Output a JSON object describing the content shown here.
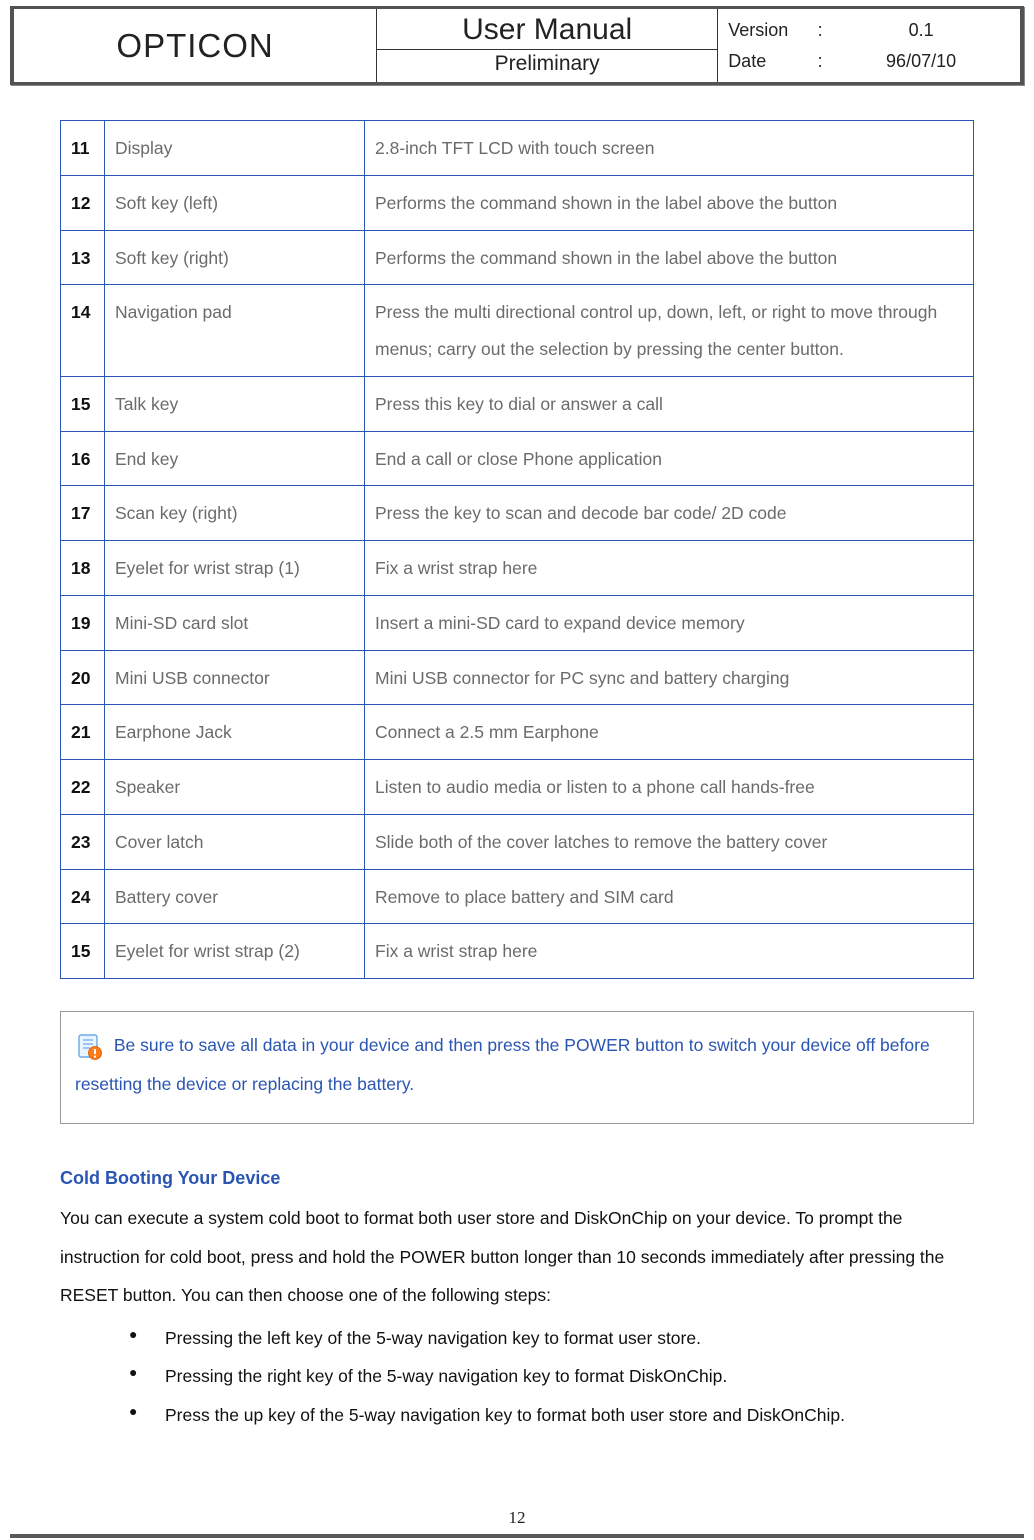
{
  "header": {
    "brand": "OPTICON",
    "title": "User Manual",
    "subtitle": "Preliminary",
    "meta": {
      "version_label": "Version",
      "version_value": "0.1",
      "date_label": "Date",
      "date_value": "96/07/10",
      "colon": ":"
    }
  },
  "parts": [
    {
      "num": "11",
      "name": "Display",
      "desc": "2.8-inch TFT LCD with touch screen"
    },
    {
      "num": "12",
      "name": "Soft key (left)",
      "desc": "Performs the command shown in the label above the button"
    },
    {
      "num": "13",
      "name": "Soft key (right)",
      "desc": "Performs the command shown in the label above the button"
    },
    {
      "num": "14",
      "name": "Navigation pad",
      "desc": "Press the multi directional control up, down, left, or right to move through menus; carry out the selection by pressing the center button."
    },
    {
      "num": "15",
      "name": "Talk key",
      "desc": "Press this key to dial or answer a call"
    },
    {
      "num": "16",
      "name": "End key",
      "desc": "End a call or close Phone application"
    },
    {
      "num": "17",
      "name": "Scan key (right)",
      "desc": "Press the key to scan and decode bar code/ 2D code"
    },
    {
      "num": "18",
      "name": "Eyelet for wrist strap (1)",
      "desc": "Fix a wrist strap here"
    },
    {
      "num": "19",
      "name": "Mini-SD card slot",
      "desc": "Insert a mini-SD card to expand device memory"
    },
    {
      "num": "20",
      "name": "Mini USB connector",
      "desc": "Mini USB connector for PC sync and battery charging"
    },
    {
      "num": "21",
      "name": "Earphone Jack",
      "desc": "Connect a 2.5 mm Earphone"
    },
    {
      "num": "22",
      "name": "Speaker",
      "desc": "Listen to audio media or listen to a phone call hands-free"
    },
    {
      "num": "23",
      "name": "Cover latch",
      "desc": "Slide both of the cover latches to remove the battery cover"
    },
    {
      "num": "24",
      "name": "Battery cover",
      "desc": "Remove to place battery and SIM card"
    },
    {
      "num": "15",
      "name": "Eyelet for wrist strap (2)",
      "desc": "Fix a wrist strap here"
    }
  ],
  "note": {
    "icon": "note-alert-icon",
    "text": " Be sure to save all data in your device and then press the POWER button to switch your device off before resetting the device or replacing the battery."
  },
  "section": {
    "heading": "Cold Booting Your Device",
    "body": "You can execute a system cold boot to format both user store and DiskOnChip on your device. To prompt the instruction for cold boot, press and hold the POWER button longer than 10 seconds immediately after pressing the RESET button. You can then choose one of the following steps:",
    "steps": [
      "Pressing the left key of the 5-way navigation key to format user store.",
      "Pressing the right key of the 5-way navigation key to format DiskOnChip.",
      "Press the up key of the 5-way navigation key to format both user store and DiskOnChip."
    ]
  },
  "page_number": "12"
}
